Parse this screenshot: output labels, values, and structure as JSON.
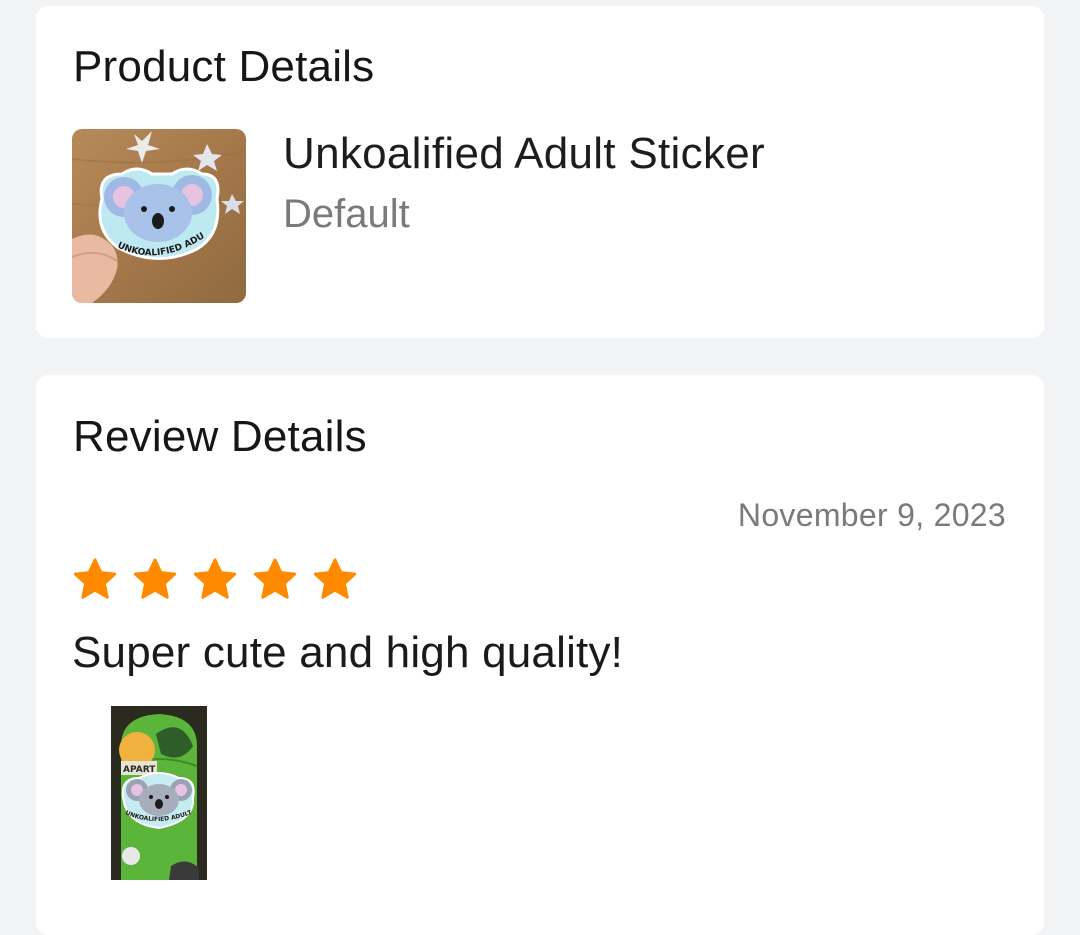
{
  "product_details": {
    "title": "Product Details",
    "product": {
      "name": "Unkoalified Adult Sticker",
      "variant": "Default",
      "image_icon": "koala-sticker-image",
      "sticker_text": "UNKOALIFIED ADULT"
    }
  },
  "review_details": {
    "title": "Review Details",
    "date": "November 9, 2023",
    "rating": 5,
    "rating_max": 5,
    "star_color": "#ff8a00",
    "text": "Super cute and high quality!",
    "photo_icon": "review-photo-image",
    "photo_sticker_texts": [
      "APART",
      "UNKOALIFIED ADULT"
    ]
  }
}
